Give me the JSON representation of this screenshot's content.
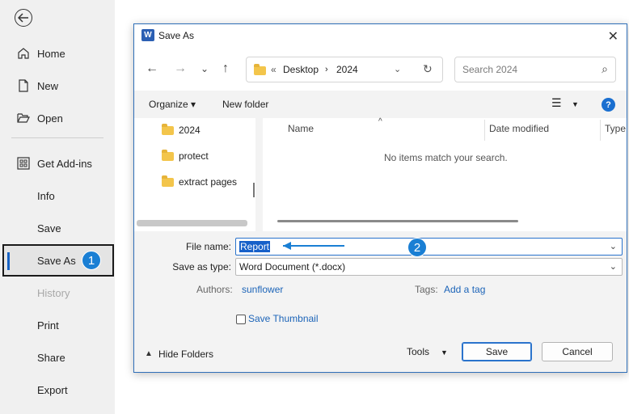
{
  "sidebar": {
    "items": [
      {
        "label": "Home",
        "icon": "home-icon"
      },
      {
        "label": "New",
        "icon": "new-document-icon"
      },
      {
        "label": "Open",
        "icon": "open-folder-icon"
      },
      {
        "label": "Get Add-ins",
        "icon": "add-ins-grid-icon"
      },
      {
        "label": "Info"
      },
      {
        "label": "Save"
      },
      {
        "label": "Save As"
      },
      {
        "label": "History"
      },
      {
        "label": "Print"
      },
      {
        "label": "Share"
      },
      {
        "label": "Export"
      }
    ],
    "step_badge": "1"
  },
  "dialog": {
    "title": "Save As",
    "address": {
      "prefix": "«",
      "crumbs": [
        "Desktop",
        "2024"
      ]
    },
    "search_placeholder": "Search 2024",
    "commands": {
      "organize": "Organize ▾",
      "new_folder": "New folder"
    },
    "tree": [
      "2024",
      "protect",
      "extract pages"
    ],
    "columns": [
      "Name",
      "Date modified",
      "Type"
    ],
    "empty_message": "No items match your search.",
    "file_name_label": "File name:",
    "file_name_value": "Report",
    "save_as_type_label": "Save as type:",
    "save_as_type_value": "Word Document (*.docx)",
    "authors_label": "Authors:",
    "authors_value": "sunflower",
    "tags_label": "Tags:",
    "tags_value": "Add a tag",
    "save_thumbnail": "Save Thumbnail",
    "hide_folders": "Hide Folders",
    "tools": "Tools",
    "save_button": "Save",
    "cancel_button": "Cancel",
    "step_badge": "2",
    "accent": "#1a7fd4"
  }
}
